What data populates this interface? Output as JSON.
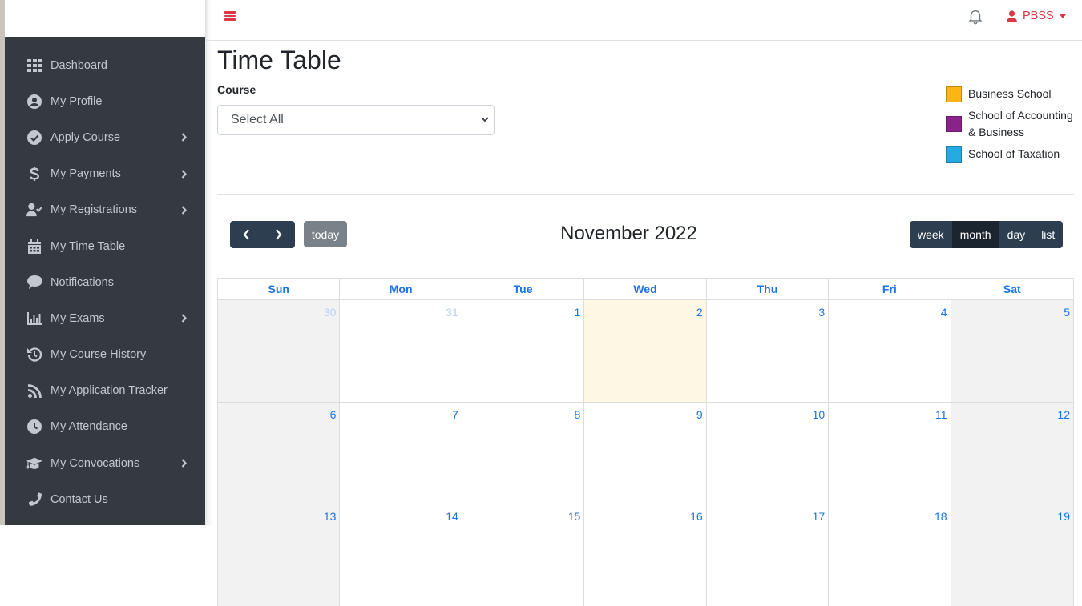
{
  "sidebar": {
    "items": [
      {
        "label": "Dashboard",
        "icon": "grid-icon",
        "has_submenu": false
      },
      {
        "label": "My Profile",
        "icon": "user-circle-icon",
        "has_submenu": false
      },
      {
        "label": "Apply Course",
        "icon": "check-circle-icon",
        "has_submenu": true
      },
      {
        "label": "My Payments",
        "icon": "dollar-icon",
        "has_submenu": true
      },
      {
        "label": "My Registrations",
        "icon": "user-check-icon",
        "has_submenu": true
      },
      {
        "label": "My Time Table",
        "icon": "calendar-icon",
        "has_submenu": false
      },
      {
        "label": "Notifications",
        "icon": "comment-icon",
        "has_submenu": false
      },
      {
        "label": "My Exams",
        "icon": "bar-chart-icon",
        "has_submenu": true
      },
      {
        "label": "My Course History",
        "icon": "history-icon",
        "has_submenu": false
      },
      {
        "label": "My Application Tracker",
        "icon": "rss-icon",
        "has_submenu": false
      },
      {
        "label": "My Attendance",
        "icon": "clock-icon",
        "has_submenu": false
      },
      {
        "label": "My Convocations",
        "icon": "graduation-cap-icon",
        "has_submenu": true
      },
      {
        "label": "Contact Us",
        "icon": "phone-icon",
        "has_submenu": false
      }
    ]
  },
  "topbar": {
    "user_name": "PBSS",
    "accent_color": "#dc3545"
  },
  "page": {
    "title": "Time Table",
    "course_label": "Course",
    "course_selected": "Select All"
  },
  "legend": [
    {
      "label": "Business School",
      "color": "#fbb614"
    },
    {
      "label": "School of Accounting & Business",
      "color": "#8a2389"
    },
    {
      "label": "School of Taxation",
      "color": "#27aae1"
    }
  ],
  "calendar": {
    "title": "November 2022",
    "today_label": "today",
    "views": [
      {
        "label": "week",
        "active": false
      },
      {
        "label": "month",
        "active": true
      },
      {
        "label": "day",
        "active": false
      },
      {
        "label": "list",
        "active": false
      }
    ],
    "weekdays": [
      "Sun",
      "Mon",
      "Tue",
      "Wed",
      "Thu",
      "Fri",
      "Sat"
    ],
    "weeks": [
      [
        {
          "n": "30",
          "other": true
        },
        {
          "n": "31",
          "other": true
        },
        {
          "n": "1"
        },
        {
          "n": "2",
          "today": true
        },
        {
          "n": "3"
        },
        {
          "n": "4"
        },
        {
          "n": "5"
        }
      ],
      [
        {
          "n": "6"
        },
        {
          "n": "7"
        },
        {
          "n": "8"
        },
        {
          "n": "9"
        },
        {
          "n": "10"
        },
        {
          "n": "11"
        },
        {
          "n": "12"
        }
      ],
      [
        {
          "n": "13"
        },
        {
          "n": "14"
        },
        {
          "n": "15"
        },
        {
          "n": "16"
        },
        {
          "n": "17"
        },
        {
          "n": "18"
        },
        {
          "n": "19"
        }
      ]
    ]
  }
}
